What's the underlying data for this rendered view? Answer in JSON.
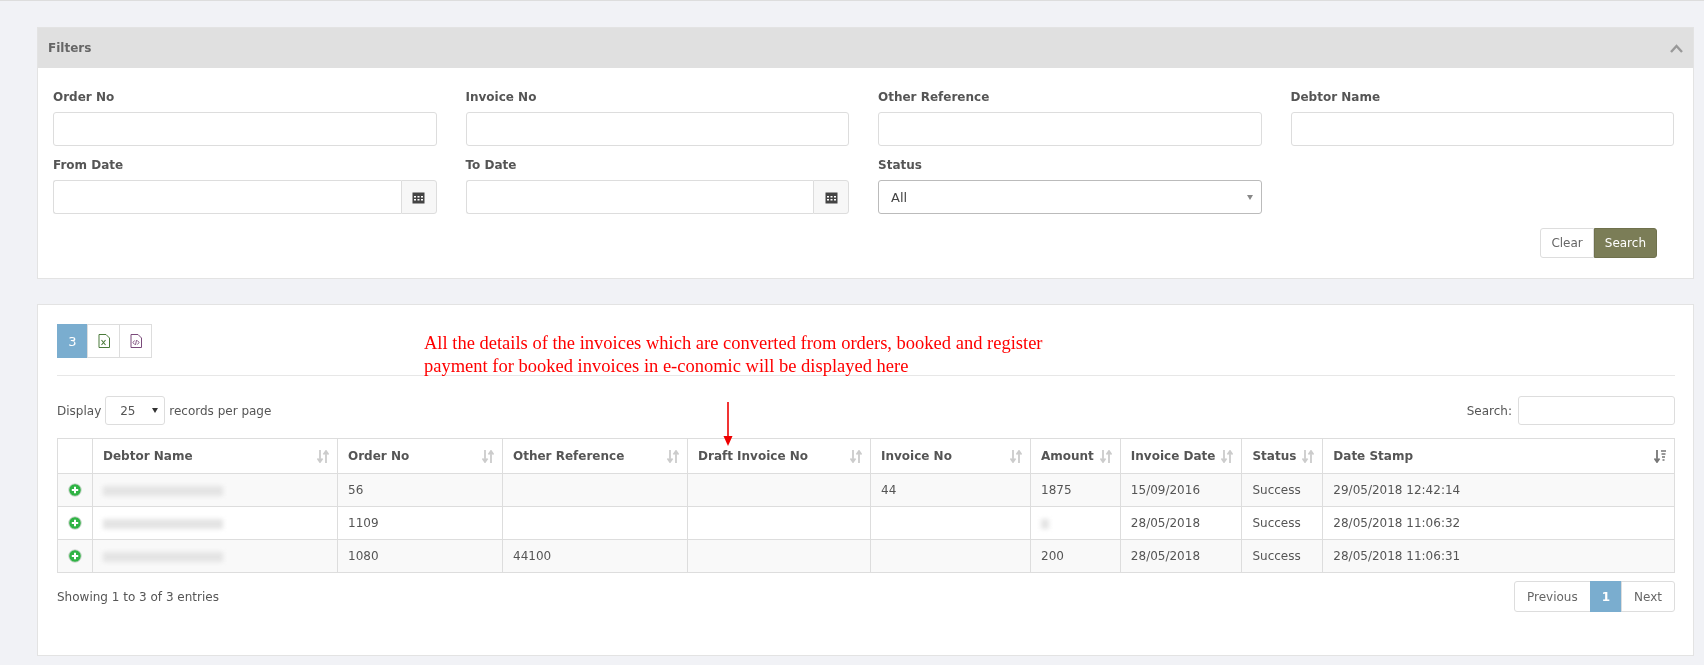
{
  "filters": {
    "title": "Filters",
    "expanded": true,
    "fields": [
      {
        "kind": "text",
        "label": "Order No"
      },
      {
        "kind": "text",
        "label": "Invoice No"
      },
      {
        "kind": "text",
        "label": "Other Reference"
      },
      {
        "kind": "text",
        "label": "Debtor Name"
      },
      {
        "kind": "date",
        "label": "From Date"
      },
      {
        "kind": "date",
        "label": "To Date"
      },
      {
        "kind": "select",
        "label": "Status",
        "value": "All"
      }
    ],
    "buttons": [
      {
        "kind": "default",
        "label": "Clear"
      },
      {
        "kind": "primary",
        "label": "Search"
      }
    ]
  },
  "results": {
    "toolbar": [
      {
        "kind": "count",
        "label": "3"
      },
      {
        "kind": "excel"
      },
      {
        "kind": "pdf"
      }
    ],
    "annotation": "All the details of the invoices which are converted from orders, booked and register payment for booked invoices in e-conomic will be displayed here",
    "length": {
      "before": "Display",
      "value": "25",
      "after": "records per page"
    },
    "search": {
      "label": "Search:"
    },
    "table": {
      "columns": [
        {
          "label": "Debtor Name",
          "sorted": false
        },
        {
          "label": "Order No",
          "sorted": false
        },
        {
          "label": "Other Reference",
          "sorted": false
        },
        {
          "label": "Draft Invoice No",
          "sorted": false
        },
        {
          "label": "Invoice No",
          "sorted": false
        },
        {
          "label": "Amount",
          "sorted": false
        },
        {
          "label": "Invoice Date",
          "sorted": false
        },
        {
          "label": "Status",
          "sorted": false
        },
        {
          "label": "Date Stamp",
          "sorted": true
        }
      ],
      "rows": [
        {
          "cells": [
            {
              "blurred": true
            },
            {
              "text": "56"
            },
            {},
            {},
            {
              "text": "44"
            },
            {
              "text": "1875"
            },
            {
              "text": "15/09/2016"
            },
            {
              "text": "Success"
            },
            {
              "text": "29/05/2018 12:42:14"
            }
          ]
        },
        {
          "cells": [
            {
              "blurred": true
            },
            {
              "text": "1109"
            },
            {},
            {},
            {},
            {
              "blurred": true
            },
            {
              "text": "28/05/2018"
            },
            {
              "text": "Success"
            },
            {
              "text": "28/05/2018 11:06:32"
            }
          ]
        },
        {
          "cells": [
            {
              "blurred": true
            },
            {
              "text": "1080"
            },
            {
              "text": "44100"
            },
            {},
            {},
            {
              "text": "200"
            },
            {
              "text": "28/05/2018"
            },
            {
              "text": "Success"
            },
            {
              "text": "28/05/2018 11:06:31"
            }
          ]
        }
      ]
    },
    "info": "Showing 1 to 3 of 3 entries",
    "pagination": [
      {
        "kind": "nav",
        "label": "Previous",
        "selected": false
      },
      {
        "kind": "page",
        "label": "1",
        "selected": true
      },
      {
        "kind": "nav",
        "label": "Next",
        "selected": false
      }
    ]
  }
}
